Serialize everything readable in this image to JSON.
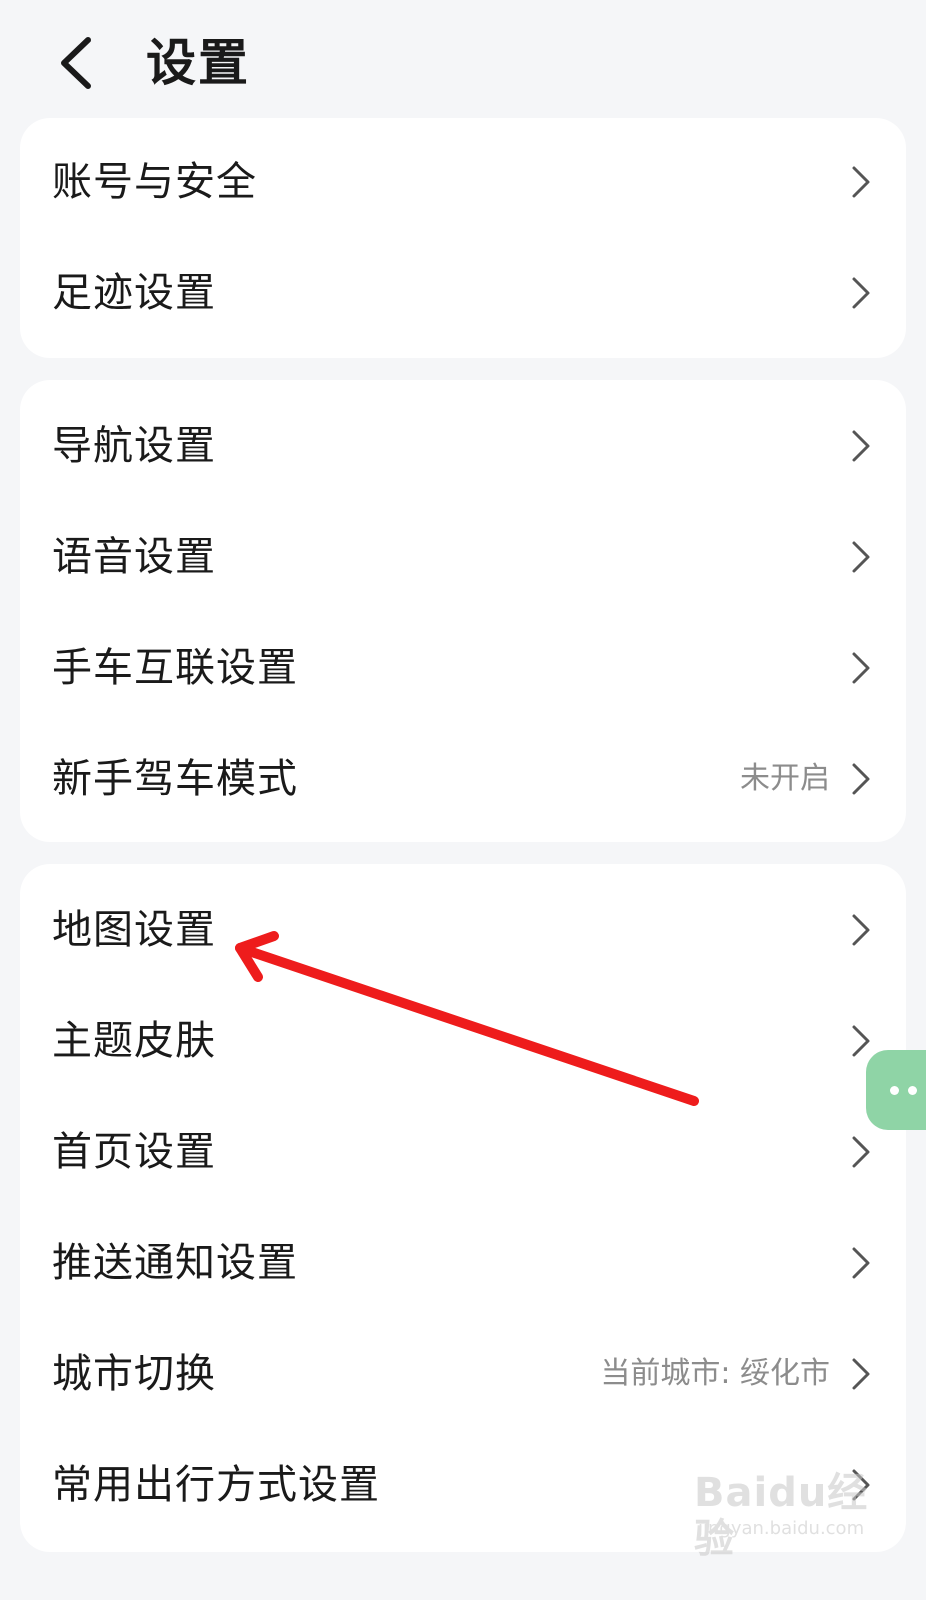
{
  "header": {
    "title": "设置",
    "back_icon": "chevron-left-icon"
  },
  "groups": [
    {
      "items": [
        {
          "label": "账号与安全"
        },
        {
          "label": "足迹设置"
        }
      ]
    },
    {
      "items": [
        {
          "label": "导航设置"
        },
        {
          "label": "语音设置"
        },
        {
          "label": "手车互联设置"
        },
        {
          "label": "新手驾车模式",
          "value": "未开启"
        }
      ]
    },
    {
      "items": [
        {
          "label": "地图设置"
        },
        {
          "label": "主题皮肤"
        },
        {
          "label": "首页设置"
        },
        {
          "label": "推送通知设置"
        },
        {
          "label": "城市切换",
          "value": "当前城市: 绥化市"
        },
        {
          "label": "常用出行方式设置"
        }
      ]
    }
  ],
  "annotation": {
    "arrow_color": "#ee1c1c",
    "points_to": "地图设置"
  },
  "floating_button": {
    "icon": "more-dots-icon",
    "color": "#8fd4a6"
  },
  "watermark": {
    "brand": "Baidu经验",
    "url": "jingyan.baidu.com"
  }
}
